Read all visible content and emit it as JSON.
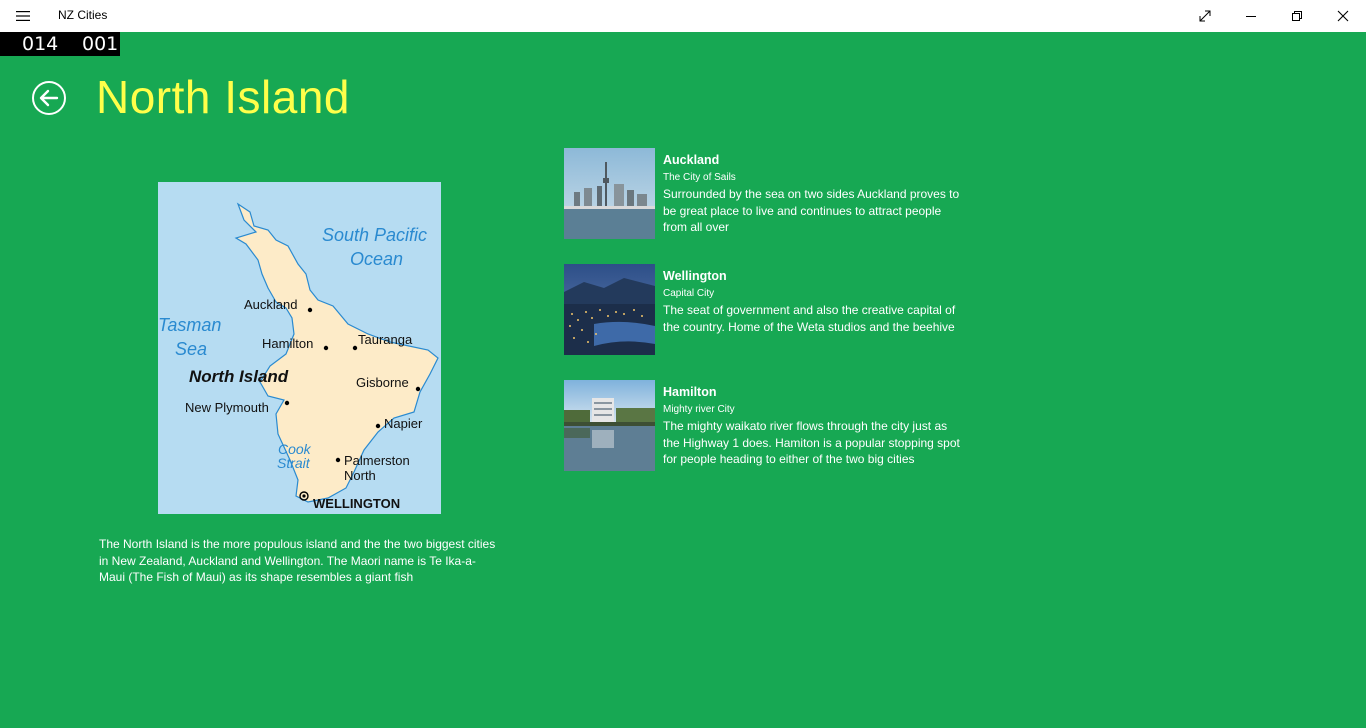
{
  "window": {
    "title": "NZ Cities"
  },
  "counter": {
    "a": "014",
    "b": "001"
  },
  "page": {
    "title": "North Island",
    "description": "The North Island is the more populous island and the the two biggest cities in New Zealand, Auckland and Wellington. The Maori name is Te Ika-a-Maui (The Fish of Maui) as its shape resembles a giant fish"
  },
  "map": {
    "labels": {
      "south_pacific": "South Pacific",
      "ocean": "Ocean",
      "tasman": "Tasman",
      "sea": "Sea",
      "auckland": "Auckland",
      "hamilton": "Hamilton",
      "tauranga": "Tauranga",
      "north_island": "North Island",
      "gisborne": "Gisborne",
      "new_plymouth": "New Plymouth",
      "napier": "Napier",
      "cook": "Cook",
      "strait": "Strait",
      "palmerston": "Palmerston",
      "north": "North",
      "wellington": "WELLINGTON"
    }
  },
  "cities": [
    {
      "name": "Auckland",
      "tagline": "The City of Sails",
      "text": "Surrounded by the sea on two sides Auckland proves to be great place to live and continues to attract people from all over"
    },
    {
      "name": "Wellington",
      "tagline": "Capital City",
      "text": "The seat of government and also the creative capital of the country. Home of the Weta studios and the beehive"
    },
    {
      "name": "Hamilton",
      "tagline": "Mighty river City",
      "text": "The mighty waikato river flows through the city just as the Highway 1 does. Hamiton is a popular stopping spot for people heading to either of the two big cities"
    }
  ],
  "colors": {
    "background": "#17a853",
    "title": "#ffff4a",
    "map_sea": "#b6dcf2",
    "map_land": "#fdebc8"
  },
  "icons": [
    "hamburger-icon",
    "fullscreen-icon",
    "minimize-icon",
    "restore-icon",
    "close-icon",
    "back-arrow-icon"
  ]
}
